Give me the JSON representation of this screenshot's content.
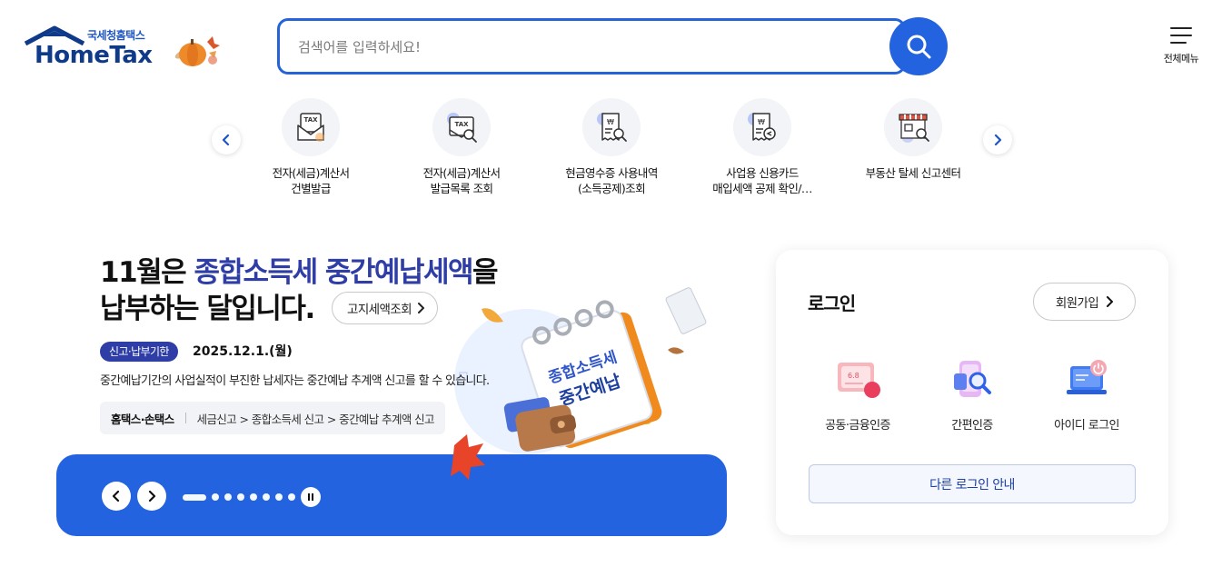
{
  "header": {
    "logo_small": "국세청홈택스",
    "logo_main": "HomeTax",
    "search_placeholder": "검색어를 입력하세요!",
    "menu_label": "전체메뉴"
  },
  "quick_menu": {
    "items": [
      {
        "line1": "전자(세금)계산서",
        "line2": "건별발급",
        "icon": "tax-envelope-icon"
      },
      {
        "line1": "전자(세금)계산서",
        "line2": "발급목록 조회",
        "icon": "tax-search-icon"
      },
      {
        "line1": "현금영수증 사용내역",
        "line2": "(소득공제)조회",
        "icon": "receipt-search-icon"
      },
      {
        "line1": "사업용 신용카드",
        "line2": "매입세액 공제 확인/…",
        "icon": "receipt-check-icon"
      },
      {
        "line1": "부동산 탈세 신고센터",
        "line2": "",
        "icon": "store-search-icon"
      }
    ]
  },
  "banner": {
    "title_pre": "11월은 ",
    "title_highlight": "종합소득세 중간예납세액",
    "title_post": "을",
    "title_line2": "납부하는 달입니다.",
    "lookup_button": "고지세액조회",
    "badge": "신고·납부기한",
    "date": "2025.12.1.(월)",
    "description": "중간예납기간의 사업실적이 부진한 납세자는 중간예납 추계액 신고를 할 수 있습니다.",
    "path_prefix": "홈택스·손택스",
    "path": "세금신고 > 종합소득세 신고 > 중간예납 추계액 신고",
    "calendar_line1": "종합소득세",
    "calendar_line2": "중간예납",
    "slides": 8,
    "active_slide": 1,
    "bar_color": "#2463e0"
  },
  "login": {
    "title": "로그인",
    "join_button": "회원가입",
    "options": [
      {
        "label": "공동·금융인증",
        "icon": "certificate-icon"
      },
      {
        "label": "간편인증",
        "icon": "simple-auth-icon"
      },
      {
        "label": "아이디 로그인",
        "icon": "id-login-icon"
      }
    ],
    "other_button": "다른 로그인 안내"
  },
  "colors": {
    "accent": "#2463e0",
    "highlight": "#2f3ea6"
  }
}
